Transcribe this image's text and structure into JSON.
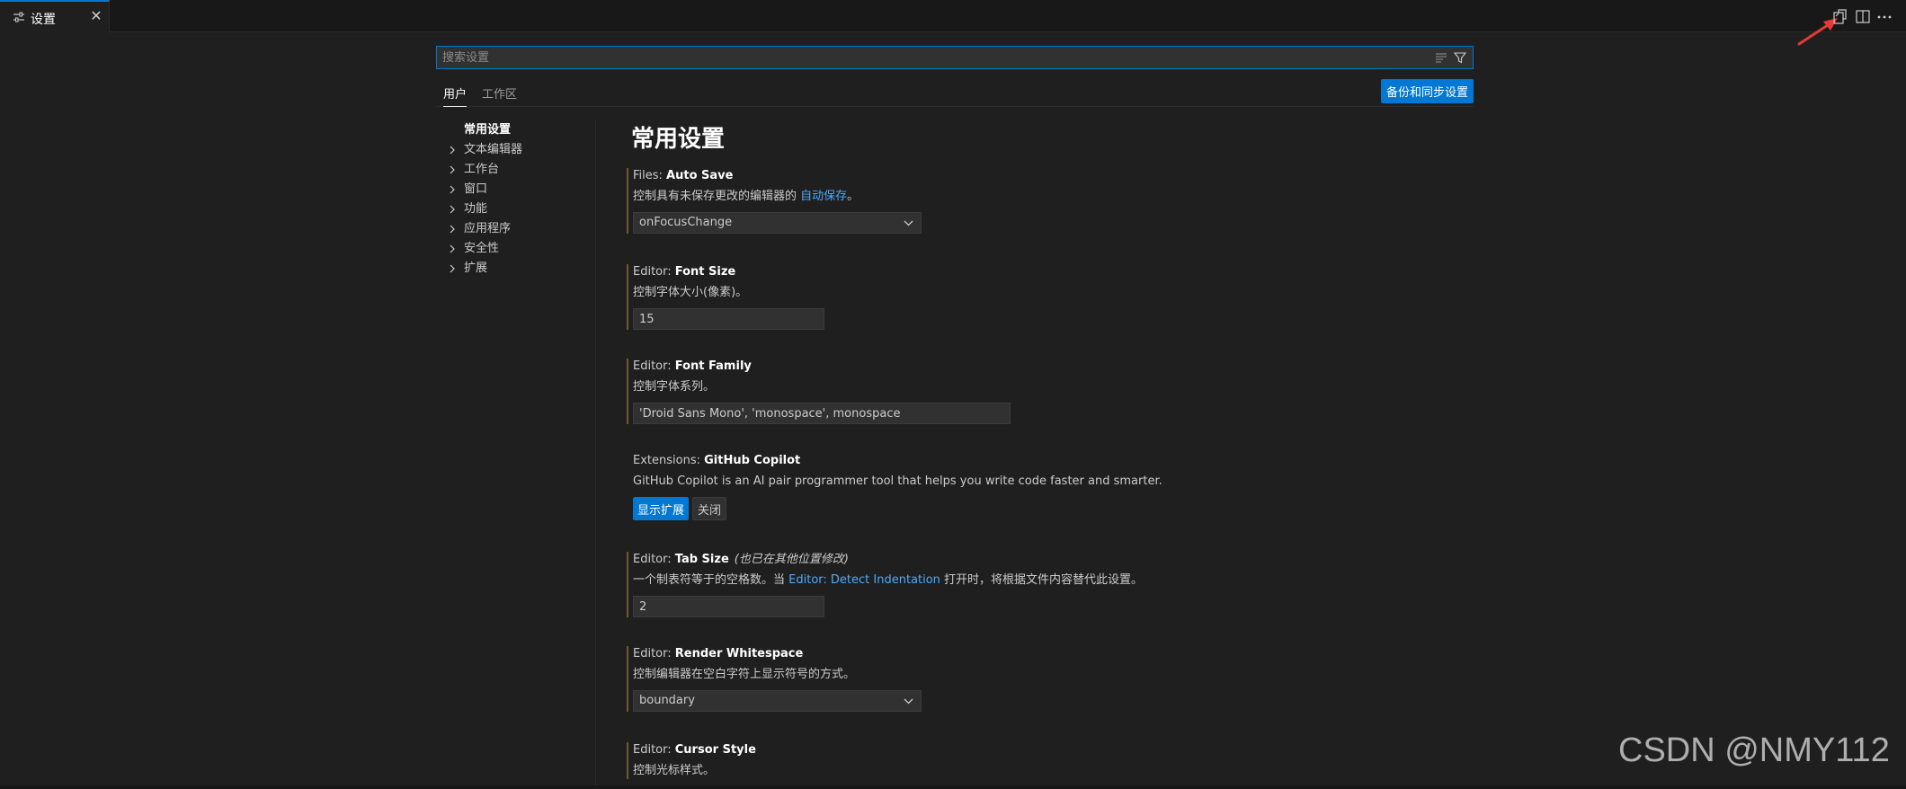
{
  "tab": {
    "label": "设置",
    "close": "✕",
    "icon": "settings-sliders-icon"
  },
  "editor_actions": [
    {
      "name": "open-settings-json-icon"
    },
    {
      "name": "split-editor-icon"
    },
    {
      "name": "more-actions-icon",
      "glyph": "···"
    }
  ],
  "search": {
    "placeholder": "搜索设置",
    "value": ""
  },
  "scope_tabs": [
    {
      "label": "用户",
      "active": true
    },
    {
      "label": "工作区",
      "active": false
    }
  ],
  "sync_button": "备份和同步设置",
  "toc": {
    "items": [
      {
        "label": "常用设置",
        "expandable": false
      },
      {
        "label": "文本编辑器",
        "expandable": true
      },
      {
        "label": "工作台",
        "expandable": true
      },
      {
        "label": "窗口",
        "expandable": true
      },
      {
        "label": "功能",
        "expandable": true
      },
      {
        "label": "应用程序",
        "expandable": true
      },
      {
        "label": "安全性",
        "expandable": true
      },
      {
        "label": "扩展",
        "expandable": true
      }
    ]
  },
  "page_title": "常用设置",
  "settings": {
    "auto_save": {
      "category": "Files: ",
      "name": "Auto Save",
      "desc_before": "控制具有未保存更改的编辑器的 ",
      "desc_link": "自动保存",
      "desc_after": "。",
      "value": "onFocusChange"
    },
    "font_size": {
      "category": "Editor: ",
      "name": "Font Size",
      "desc": "控制字体大小(像素)。",
      "value": "15"
    },
    "font_family": {
      "category": "Editor: ",
      "name": "Font Family",
      "desc": "控制字体系列。",
      "value": "'Droid Sans Mono', 'monospace', monospace"
    },
    "copilot": {
      "category": "Extensions: ",
      "name": "GitHub Copilot",
      "desc": "GitHub Copilot is an AI pair programmer tool that helps you write code faster and smarter.",
      "show_button": "显示扩展",
      "close_button": "关闭"
    },
    "tab_size": {
      "category": "Editor: ",
      "name": "Tab Size",
      "note": "(也已在其他位置修改)",
      "desc_before": "一个制表符等于的空格数。当 ",
      "desc_link": "Editor: Detect Indentation",
      "desc_after": " 打开时，将根据文件内容替代此设置。",
      "value": "2"
    },
    "render_whitespace": {
      "category": "Editor: ",
      "name": "Render Whitespace",
      "desc": "控制编辑器在空白字符上显示符号的方式。",
      "value": "boundary"
    },
    "cursor_style": {
      "category": "Editor: ",
      "name": "Cursor Style",
      "desc": "控制光标样式。"
    }
  },
  "watermark": "CSDN @NMY112",
  "colors": {
    "accent": "#0078d4",
    "link": "#4daafc",
    "modified_bar": "#6e5a2d",
    "annotation_arrow": "#e53935"
  }
}
